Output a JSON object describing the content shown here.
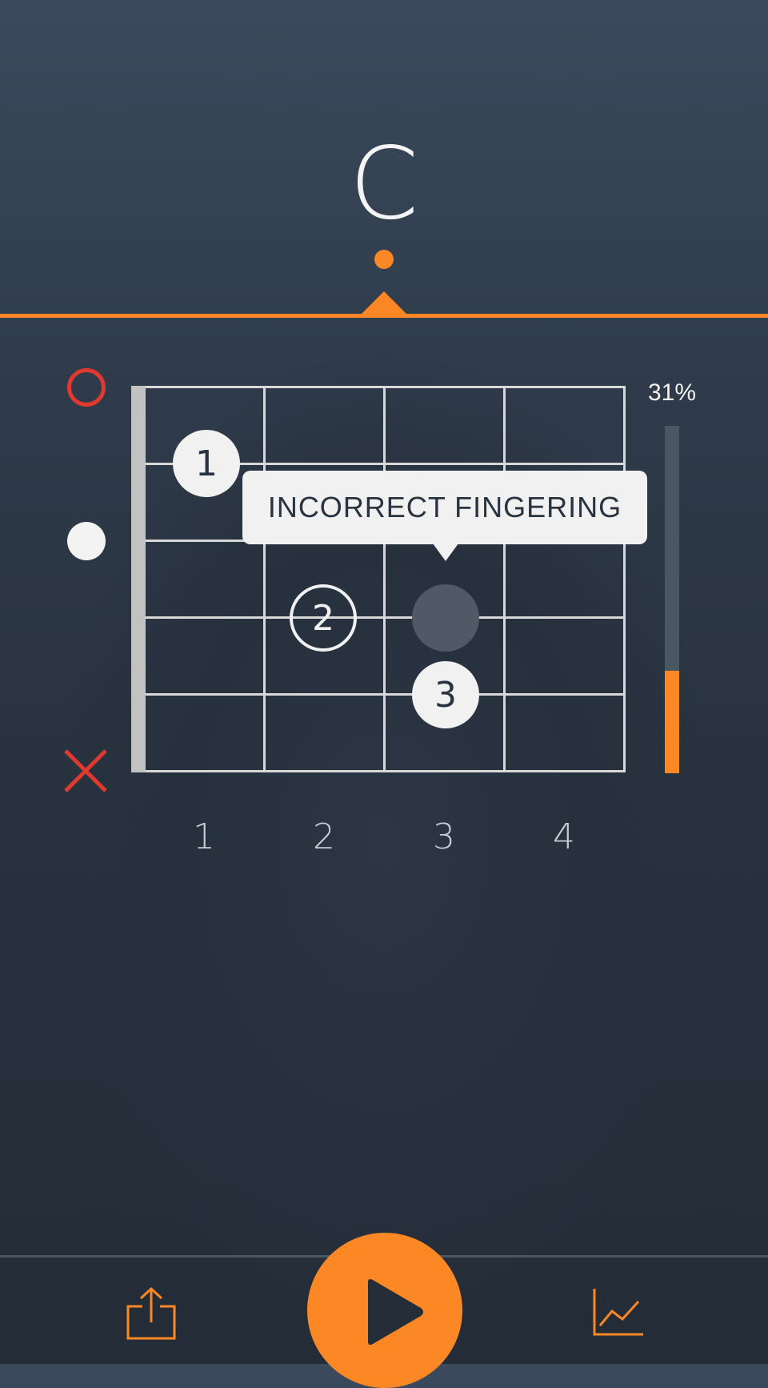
{
  "chord": {
    "name": "C"
  },
  "fretboard": {
    "tooltip": "INCORRECT FINGERING",
    "fingers": [
      {
        "label": "1",
        "fret": 1,
        "string": 2,
        "style": "filled"
      },
      {
        "label": "2",
        "fret": 2,
        "string": 4,
        "style": "outline"
      },
      {
        "label": "3",
        "fret": 3,
        "string": 5,
        "style": "filled"
      }
    ],
    "target_marker": {
      "fret": 3,
      "string": 4
    }
  },
  "string_states": [
    "open",
    "played",
    "muted"
  ],
  "fret_numbers": [
    "1",
    "2",
    "3",
    "4"
  ],
  "meter": {
    "label": "31%",
    "value_percent": 31
  },
  "icons": {
    "share": "share-icon",
    "play": "play-icon",
    "stats": "line-chart-icon",
    "open": "circle-outline-icon",
    "played": "filled-circle-icon",
    "muted": "x-icon"
  },
  "colors": {
    "accent": "#fb8825",
    "error": "#e03a2f"
  }
}
